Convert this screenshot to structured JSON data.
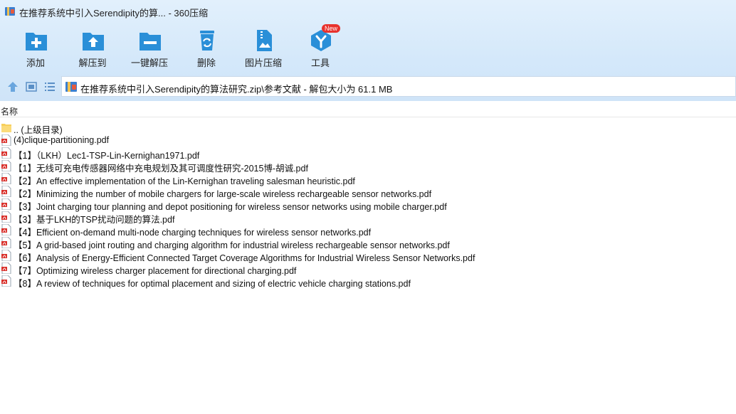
{
  "window": {
    "title": "在推荐系统中引入Serendipity的算... - 360压缩"
  },
  "toolbar": {
    "items": [
      {
        "label": "添加"
      },
      {
        "label": "解压到"
      },
      {
        "label": "一键解压"
      },
      {
        "label": "删除"
      },
      {
        "label": "图片压缩"
      },
      {
        "label": "工具"
      }
    ],
    "new_badge": "New"
  },
  "path": {
    "text": "在推荐系统中引入Serendipity的算法研究.zip\\参考文献 - 解包大小为 61.1 MB"
  },
  "columns": {
    "name": "名称"
  },
  "files": [
    {
      "name": ".. (上级目录)",
      "type": "folder"
    },
    {
      "name": "(4)clique-partitioning.pdf",
      "type": "pdf"
    },
    {
      "name": "【1】（LKH）Lec1-TSP-Lin-Kernighan1971.pdf",
      "type": "pdf"
    },
    {
      "name": "【1】无线可充电传感器网络中充电规划及其可调度性研究-2015博-胡诚.pdf",
      "type": "pdf"
    },
    {
      "name": "【2】An effective implementation of the Lin-Kernighan traveling salesman heuristic.pdf",
      "type": "pdf"
    },
    {
      "name": "【2】Minimizing the number of mobile chargers for large-scale wireless rechargeable sensor networks.pdf",
      "type": "pdf"
    },
    {
      "name": "【3】Joint charging tour planning and depot positioning for wireless sensor networks using mobile charger.pdf",
      "type": "pdf"
    },
    {
      "name": "【3】基于LKH的TSP扰动问题的算法.pdf",
      "type": "pdf"
    },
    {
      "name": "【4】Efficient on-demand multi-node charging techniques for wireless sensor networks.pdf",
      "type": "pdf"
    },
    {
      "name": "【5】A grid-based joint routing and charging algorithm for industrial wireless rechargeable sensor networks.pdf",
      "type": "pdf"
    },
    {
      "name": "【6】Analysis of Energy-Efficient Connected Target Coverage Algorithms for Industrial Wireless Sensor Networks.pdf",
      "type": "pdf"
    },
    {
      "name": "【7】Optimizing wireless charger placement for directional charging.pdf",
      "type": "pdf"
    },
    {
      "name": "【8】A review of techniques for optimal placement and sizing of electric vehicle charging stations.pdf",
      "type": "pdf"
    }
  ],
  "colors": {
    "toolbar_bg": "#d4e8fa",
    "icon_blue": "#2a8fd8",
    "badge_red": "#e8322d",
    "pdf_red": "#d9302b"
  }
}
